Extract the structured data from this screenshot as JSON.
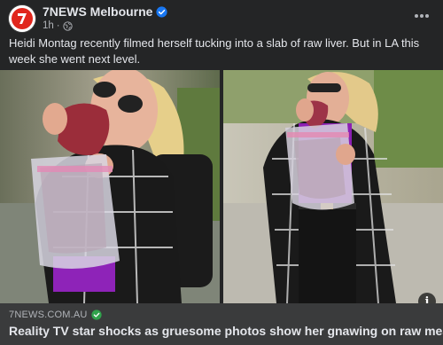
{
  "post": {
    "page_name": "7NEWS Melbourne",
    "time": "1h",
    "avatar_logo_text": "7NEWS",
    "caption": "Heidi Montag recently filmed herself tucking into a slab of raw liver. But in LA this week she went next level."
  },
  "link_preview": {
    "domain": "7NEWS.COM.AU",
    "headline": "Reality TV star shocks as gruesome photos show her gnawing on raw meat"
  },
  "icons": {
    "verified": "verified-badge-icon",
    "audience": "globe-icon",
    "more": "more-options-icon",
    "info": "info-icon",
    "domain_check": "check-circle-icon"
  },
  "colors": {
    "background": "#242526",
    "text": "#e4e6eb",
    "secondary_text": "#b0b3b8",
    "verified_blue": "#1877f2",
    "link_bg": "#3a3b3c",
    "domain_check": "#31a24c"
  }
}
